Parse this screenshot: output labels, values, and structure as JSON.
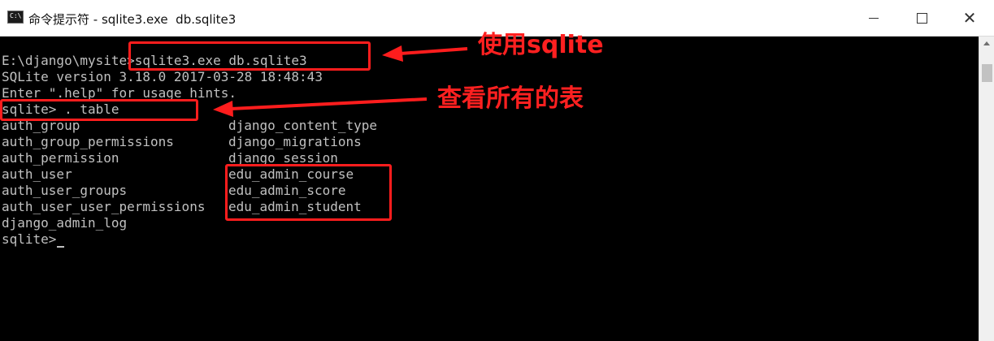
{
  "window": {
    "icon_text": "C:\\",
    "title": "命令提示符 - sqlite3.exe  db.sqlite3",
    "min_icon": "minimize-icon",
    "max_icon": "maximize-icon",
    "close_icon": "close-icon"
  },
  "console": {
    "prompt_path": "E:\\django\\mysite>",
    "command": "sqlite3.exe db.sqlite3",
    "version_line": "SQLite version 3.18.0 2017-03-28 18:48:43",
    "hint_line": "Enter \".help\" for usage hints.",
    "table_prompt": "sqlite> . table",
    "tables_left": [
      "auth_group",
      "auth_group_permissions",
      "auth_permission",
      "auth_user",
      "auth_user_groups",
      "auth_user_user_permissions",
      "django_admin_log"
    ],
    "tables_right": [
      "django_content_type",
      "django_migrations",
      "django_session",
      "edu_admin_course",
      "edu_admin_score",
      "edu_admin_student"
    ],
    "final_prompt": "sqlite>"
  },
  "annotations": {
    "note_sqlite": "使用sqlite",
    "note_tables": "查看所有的表",
    "color": "#ff1d1d"
  },
  "colors": {
    "console_bg": "#000000",
    "console_text": "#c0c0c0"
  }
}
